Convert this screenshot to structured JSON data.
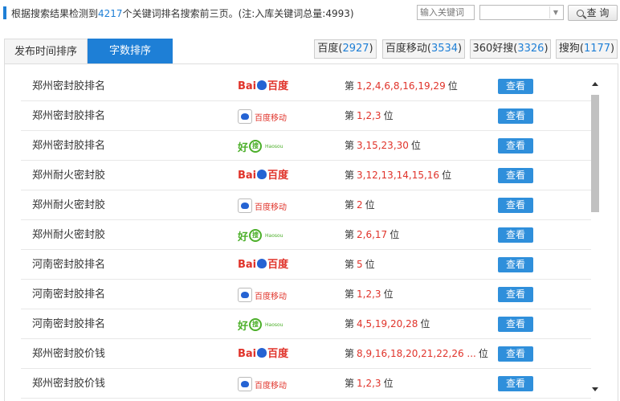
{
  "summary": {
    "prefix": "根据搜索结果检测到",
    "count": "4217",
    "suffix": "个关键词排名搜索前三页。(注:入库关键词总量:4993)"
  },
  "search": {
    "placeholder": "输入关键词",
    "select_value": "",
    "query_label": "查 询"
  },
  "tabs": [
    {
      "label": "发布时间排序",
      "active": false
    },
    {
      "label": "字数排序",
      "active": true
    }
  ],
  "engines": [
    {
      "label": "百度",
      "count": "2927"
    },
    {
      "label": "百度移动",
      "count": "3534"
    },
    {
      "label": "360好搜",
      "count": "3326"
    },
    {
      "label": "搜狗",
      "count": "1177"
    }
  ],
  "rank_prefix": "第",
  "rank_suffix": "位",
  "view_label": "查看",
  "logo_text": {
    "baidu_left": "Bai",
    "baidu_right": "百度",
    "baidu_mobile": "百度移动",
    "haosou_hao": "好",
    "haosou_sou": "搜",
    "haosou_latin": "Haosou"
  },
  "colors": {
    "accent": "#1e7fd6",
    "rank_red": "#e0332a",
    "view_button": "#2f8fdb",
    "haosou_green": "#4caf2a"
  },
  "rows": [
    {
      "keyword": "郑州密封胶排名",
      "engine": "baidu",
      "positions": "1,2,4,6,8,16,19,29"
    },
    {
      "keyword": "郑州密封胶排名",
      "engine": "baidu-mobile",
      "positions": "1,2,3"
    },
    {
      "keyword": "郑州密封胶排名",
      "engine": "haosou",
      "positions": "3,15,23,30"
    },
    {
      "keyword": "郑州耐火密封胶",
      "engine": "baidu",
      "positions": "3,12,13,14,15,16"
    },
    {
      "keyword": "郑州耐火密封胶",
      "engine": "baidu-mobile",
      "positions": "2"
    },
    {
      "keyword": "郑州耐火密封胶",
      "engine": "haosou",
      "positions": "2,6,17"
    },
    {
      "keyword": "河南密封胶排名",
      "engine": "baidu",
      "positions": "5"
    },
    {
      "keyword": "河南密封胶排名",
      "engine": "baidu-mobile",
      "positions": "1,2,3"
    },
    {
      "keyword": "河南密封胶排名",
      "engine": "haosou",
      "positions": "4,5,19,20,28"
    },
    {
      "keyword": "郑州密封胶价钱",
      "engine": "baidu",
      "positions": "8,9,16,18,20,21,22,26 ..."
    },
    {
      "keyword": "郑州密封胶价钱",
      "engine": "baidu-mobile",
      "positions": "1,2,3"
    }
  ]
}
